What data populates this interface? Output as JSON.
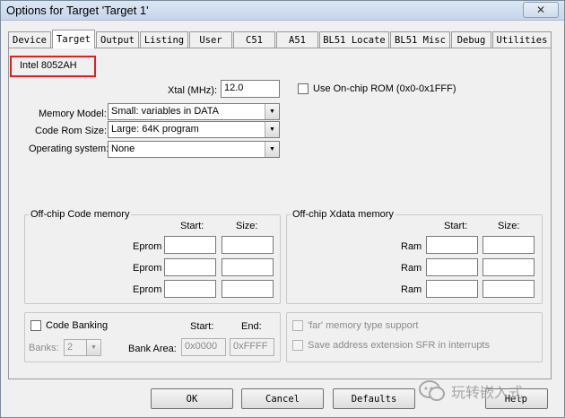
{
  "window": {
    "title": "Options for Target 'Target 1'",
    "close_glyph": "✕"
  },
  "tabs": [
    {
      "label": "Device"
    },
    {
      "label": "Target"
    },
    {
      "label": "Output"
    },
    {
      "label": "Listing"
    },
    {
      "label": "User"
    },
    {
      "label": "C51"
    },
    {
      "label": "A51"
    },
    {
      "label": "BL51 Locate"
    },
    {
      "label": "BL51 Misc"
    },
    {
      "label": "Debug"
    },
    {
      "label": "Utilities"
    }
  ],
  "target": {
    "device": "Intel 8052AH",
    "xtal_label": "Xtal (MHz):",
    "xtal_value": "12.0",
    "onchip_rom_label": "Use On-chip ROM (0x0-0x1FFF)",
    "memory_model_label": "Memory Model:",
    "memory_model_value": "Small: variables in DATA",
    "code_rom_label": "Code Rom Size:",
    "code_rom_value": "Large: 64K program",
    "os_label": "Operating system:",
    "os_value": "None"
  },
  "code_memory": {
    "title": "Off-chip Code memory",
    "start_label": "Start:",
    "size_label": "Size:",
    "rows": [
      {
        "label": "Eprom"
      },
      {
        "label": "Eprom"
      },
      {
        "label": "Eprom"
      }
    ]
  },
  "xdata_memory": {
    "title": "Off-chip Xdata memory",
    "start_label": "Start:",
    "size_label": "Size:",
    "rows": [
      {
        "label": "Ram"
      },
      {
        "label": "Ram"
      },
      {
        "label": "Ram"
      }
    ]
  },
  "banking": {
    "code_banking_label": "Code Banking",
    "start_label": "Start:",
    "end_label": "End:",
    "banks_label": "Banks:",
    "banks_value": "2",
    "bank_area_label": "Bank Area:",
    "bank_area_start": "0x0000",
    "bank_area_end": "0xFFFF",
    "far_memory_label": "'far' memory type support",
    "sfr_label": "Save address extension SFR in interrupts"
  },
  "buttons": {
    "ok": "OK",
    "cancel": "Cancel",
    "defaults": "Defaults",
    "help": "Help"
  },
  "watermark": {
    "text": "玩转嵌入式"
  }
}
